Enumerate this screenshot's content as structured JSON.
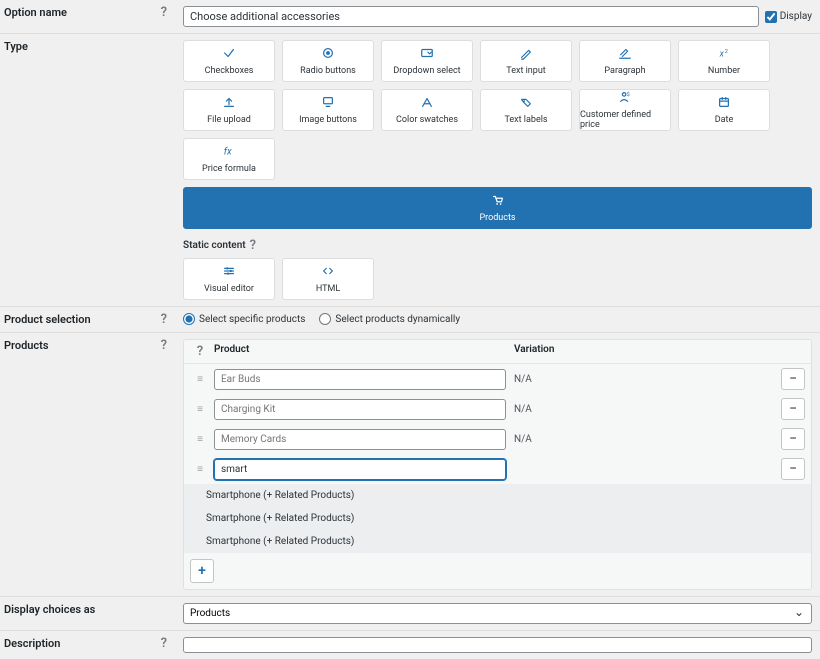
{
  "labels": {
    "option_name": "Option name",
    "type": "Type",
    "product_selection": "Product selection",
    "products": "Products",
    "display_choices": "Display choices as",
    "description": "Description"
  },
  "option_name": {
    "value": "Choose additional accessories",
    "display_label": "Display",
    "display_checked": true
  },
  "type": {
    "static_header": "Static content",
    "tiles": [
      "Checkboxes",
      "Radio buttons",
      "Dropdown select",
      "Text input",
      "Paragraph",
      "Number",
      "File upload",
      "Image buttons",
      "Color swatches",
      "Text labels",
      "Customer defined price",
      "Date",
      "Price formula",
      "Products"
    ],
    "static_tiles": [
      "Visual editor",
      "HTML"
    ],
    "selected": "Products"
  },
  "icons": {
    "Checkboxes": "checkbox",
    "Radio buttons": "radio",
    "Dropdown select": "dropdown",
    "Text input": "pencil",
    "Paragraph": "pencil-ul",
    "Number": "number",
    "File upload": "upload",
    "Image buttons": "monitor",
    "Color swatches": "palette",
    "Text labels": "tag",
    "Customer defined price": "person-dollar",
    "Date": "calendar",
    "Price formula": "fx",
    "Products": "cart",
    "Visual editor": "sliders",
    "HTML": "code"
  },
  "product_selection": {
    "options": [
      "Select specific products",
      "Select products dynamically"
    ],
    "selected": "Select specific products"
  },
  "products": {
    "head_product": "Product",
    "head_variation": "Variation",
    "rows": [
      {
        "placeholder": "Ear Buds",
        "variation": "N/A"
      },
      {
        "placeholder": "Charging Kit",
        "variation": "N/A"
      },
      {
        "placeholder": "Memory Cards",
        "variation": "N/A"
      }
    ],
    "active_input": "smart",
    "suggestions": [
      "Smartphone (+ Related Products)",
      "Smartphone (+ Related Products)",
      "Smartphone (+ Related Products)"
    ]
  },
  "display_choices": {
    "selected": "Products"
  },
  "glyph": {
    "minus": "−",
    "plus": "+"
  }
}
